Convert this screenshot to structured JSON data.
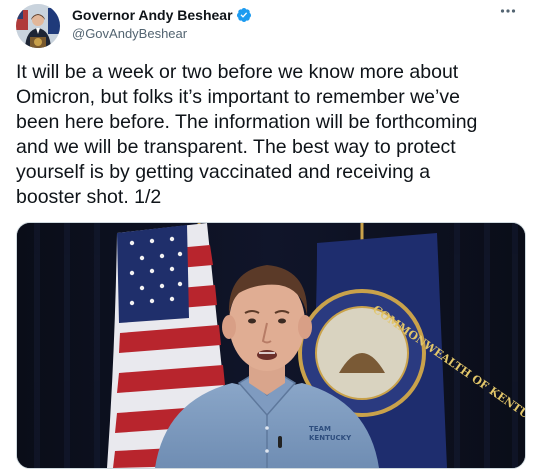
{
  "tweet": {
    "display_name": "Governor Andy Beshear",
    "handle": "@GovAndyBeshear",
    "verified_icon": "verified-badge-icon",
    "more_icon": "more-options-icon",
    "text": "It will be a week or two before we know more about\nOmicron, but folks it’s important to remember we’ve\nbeen here before. The information will be forthcoming\nand we will be transparent. The best way to protect\nyourself is by getting vaccinated and receiving a\nbooster shot. 1/2"
  },
  "media": {
    "shirt_text_line1": "TEAM",
    "shirt_text_line2": "KENTUCKY",
    "seal_text": "COMMONWEALTH OF KENTUCKY"
  },
  "colors": {
    "accent": "#1d9bf0",
    "secondary_text": "#536471",
    "primary_text": "#0f1419"
  }
}
